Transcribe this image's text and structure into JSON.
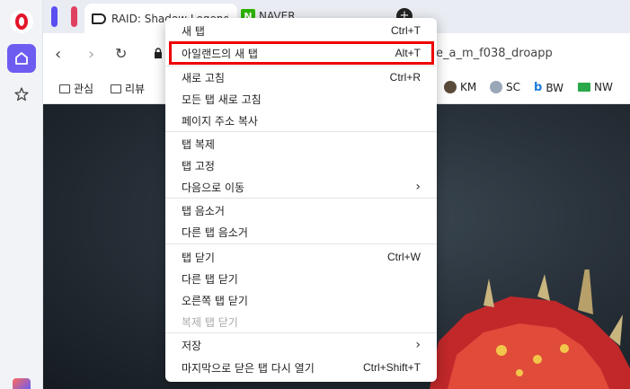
{
  "browser": {
    "tabs": [
      {
        "title": "RAID: Shadow Legends"
      },
      {
        "title": "NAVER",
        "icon_letter": "N"
      }
    ],
    "url_tail": "e_a_m_f038_droapp"
  },
  "bookmarks": [
    {
      "label": "관심",
      "icon": "folder-icon"
    },
    {
      "label": "리뷰",
      "icon": "folder-icon"
    },
    {
      "label": "KM",
      "icon": "km-icon"
    },
    {
      "label": "SC",
      "icon": "sc-icon"
    },
    {
      "label": "BW",
      "icon": "bing-icon"
    },
    {
      "label": "NW",
      "icon": "monitor-icon"
    }
  ],
  "menu": {
    "items": [
      {
        "label": "새 탭",
        "shortcut": "Ctrl+T"
      },
      {
        "label": "아일랜드의 새 탭",
        "shortcut": "Alt+T"
      },
      {
        "label": "새로 고침",
        "shortcut": "Ctrl+R"
      },
      {
        "label": "모든 탭 새로 고침",
        "shortcut": ""
      },
      {
        "label": "페이지 주소 복사",
        "shortcut": ""
      },
      {
        "label": "탭 복제",
        "shortcut": ""
      },
      {
        "label": "탭 고정",
        "shortcut": ""
      },
      {
        "label": "다음으로 이동",
        "shortcut": ""
      },
      {
        "label": "탭 음소거",
        "shortcut": ""
      },
      {
        "label": "다른 탭 음소거",
        "shortcut": ""
      },
      {
        "label": "탭 닫기",
        "shortcut": "Ctrl+W"
      },
      {
        "label": "다른 탭 닫기",
        "shortcut": ""
      },
      {
        "label": "오른쪽 탭 닫기",
        "shortcut": ""
      },
      {
        "label": "복제 탭 닫기",
        "shortcut": "",
        "disabled": true
      },
      {
        "label": "저장",
        "shortcut": ""
      },
      {
        "label": "마지막으로 닫은 탭 다시 열기",
        "shortcut": "Ctrl+Shift+T"
      }
    ],
    "submenu_arrow": "›"
  },
  "colors": {
    "highlight_border": "#ee0000",
    "opera_red": "#e3152a",
    "home_purple": "#6d5cf0"
  }
}
